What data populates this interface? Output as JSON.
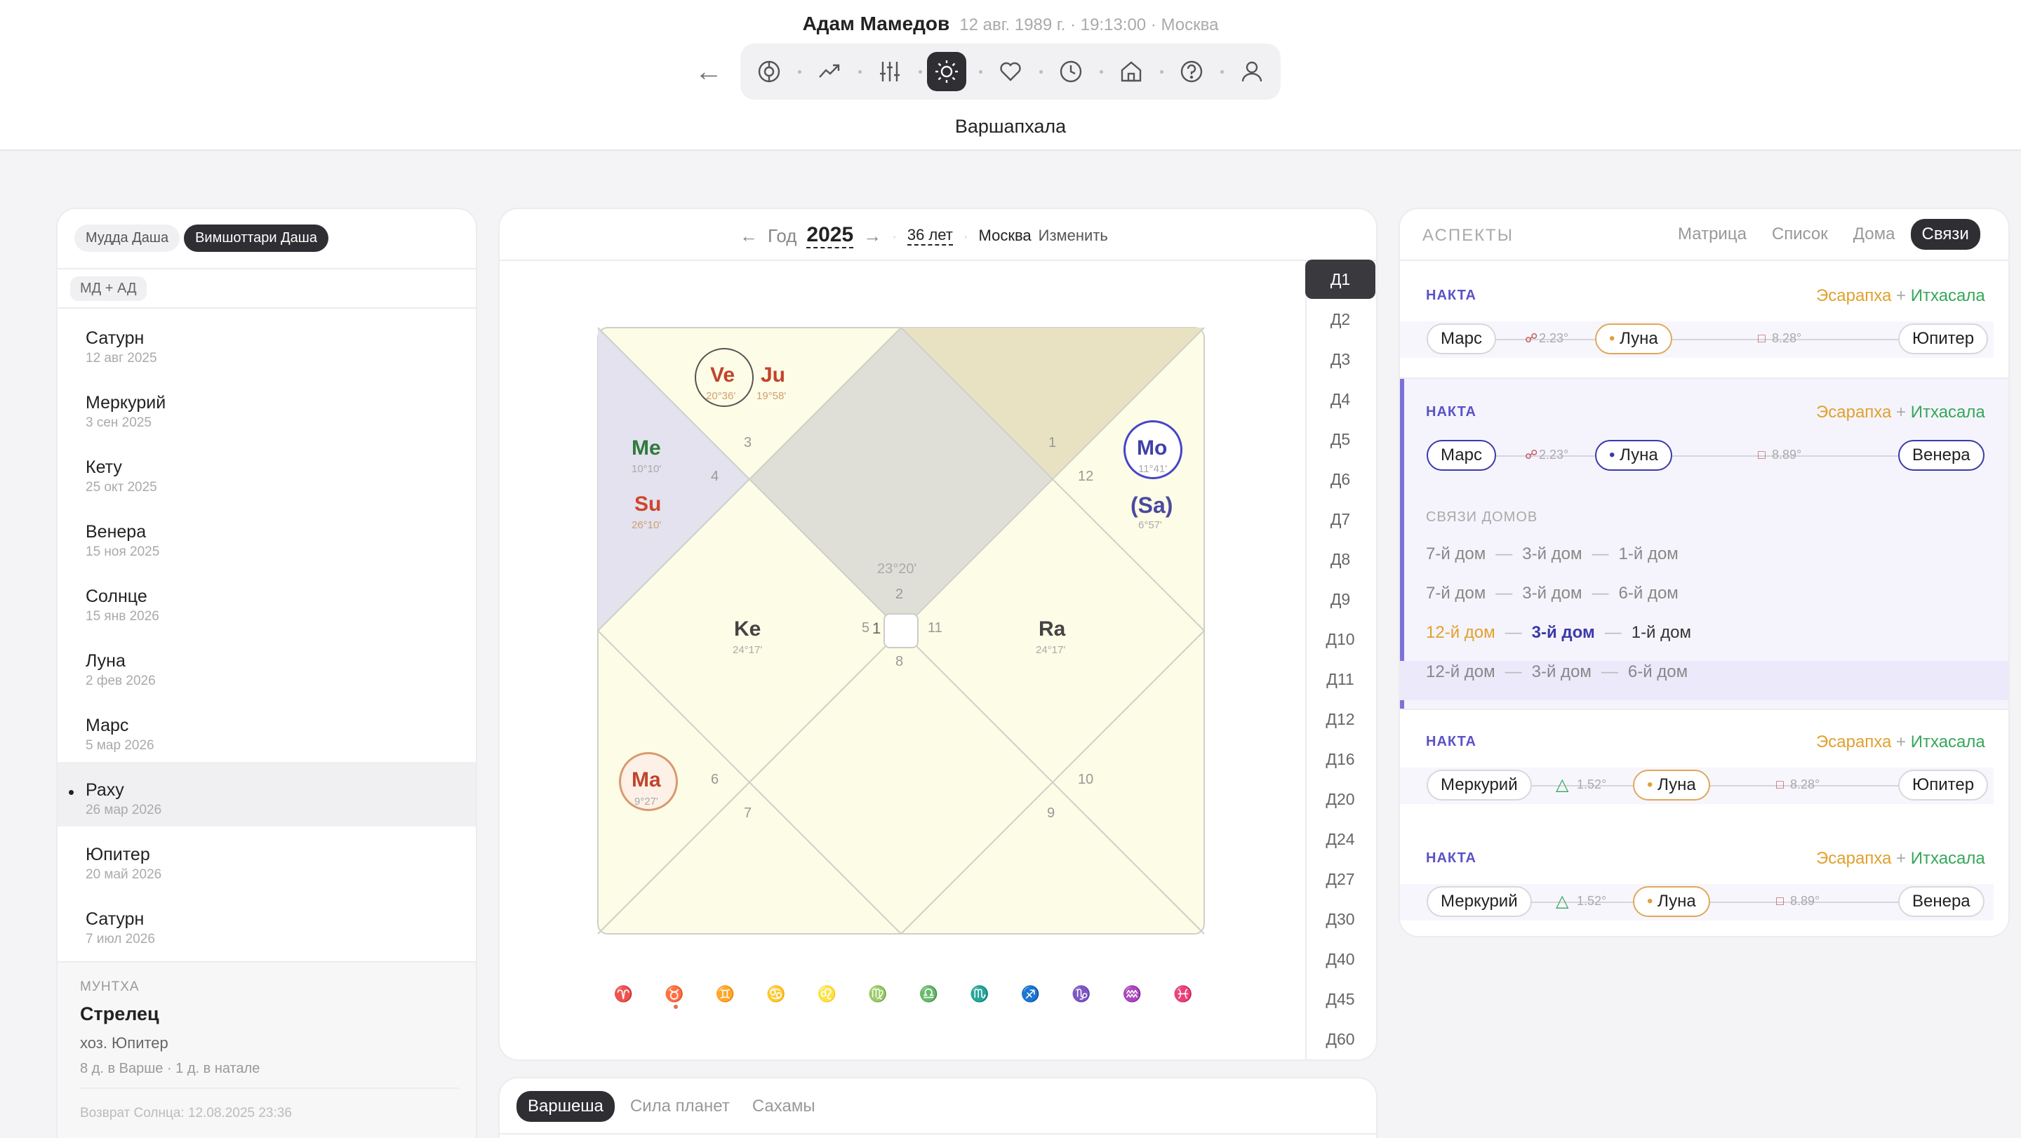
{
  "header": {
    "name": "Адам Мамедов",
    "subtitle": "12 авг. 1989 г. · 19:13:00 · Москва",
    "back": "←",
    "page_title": "Варшапхала"
  },
  "toolbar": {
    "icons": [
      "wheel-icon",
      "trend-icon",
      "sliders-icon",
      "sun-icon",
      "heart-icon",
      "clock-icon",
      "home-icon",
      "help-icon",
      "user-icon"
    ],
    "active": "sun-icon",
    "accent": "#2f2f33"
  },
  "left": {
    "tabs": [
      "Мудда Даша",
      "Вимшоттари Даша"
    ],
    "active_tab": "Вимшоттари Даша",
    "filter": "МД + АД",
    "items": [
      {
        "name": "Сатурн",
        "date": "12 авг 2025"
      },
      {
        "name": "Меркурий",
        "date": "3 сен 2025"
      },
      {
        "name": "Кету",
        "date": "25 окт 2025"
      },
      {
        "name": "Венера",
        "date": "15 ноя 2025"
      },
      {
        "name": "Солнце",
        "date": "15 янв 2026"
      },
      {
        "name": "Луна",
        "date": "2 фев 2026"
      },
      {
        "name": "Марс",
        "date": "5 мар 2026"
      },
      {
        "name": "Раху",
        "date": "26 мар 2026"
      },
      {
        "name": "Юпитер",
        "date": "20 май 2026"
      },
      {
        "name": "Сатурн",
        "date": "7 июл 2026"
      }
    ],
    "selected_index": 7,
    "muntha": {
      "label": "МУНТХА",
      "sign": "Стрелец",
      "lord": "хоз. Юпитер",
      "details": "8 д. в Варше · 1 д. в натале",
      "solar_return": "Возврат Солнца: 12.08.2025 23:36"
    }
  },
  "center": {
    "year_label": "Год",
    "year": "2025",
    "age": "36 лет",
    "city": "Москва",
    "change": "Изменить",
    "arrow_left": "←",
    "arrow_right": "→",
    "degree": "23°20'",
    "house_numbers": [
      "1",
      "2",
      "3",
      "4",
      "5",
      "6",
      "7",
      "8",
      "9",
      "10",
      "11",
      "12",
      "1"
    ],
    "planets": [
      {
        "abbr": "Ve",
        "deg": "20°36'",
        "color": "#c0442c"
      },
      {
        "abbr": "Ju",
        "deg": "19°58'",
        "color": "#c0442c"
      },
      {
        "abbr": "Me",
        "deg": "10°10'",
        "color": "#2f7a3a"
      },
      {
        "abbr": "Su",
        "deg": "26°10'",
        "color": "#d0442c"
      },
      {
        "abbr": "Mo",
        "deg": "11°41'",
        "color": "#4040a8"
      },
      {
        "abbr": "(Sa)",
        "deg": "6°57'",
        "color": "#4a4aa0"
      },
      {
        "abbr": "Ke",
        "deg": "24°17'",
        "color": "#444"
      },
      {
        "abbr": "Ra",
        "deg": "24°17'",
        "color": "#444"
      },
      {
        "abbr": "Ma",
        "deg": "9°27'",
        "color": "#c0442c"
      }
    ],
    "zodiac": [
      "♈",
      "♉",
      "♊",
      "♋",
      "♌",
      "♍",
      "♎",
      "♏",
      "♐",
      "♑",
      "♒",
      "♓"
    ],
    "div_tabs": [
      "Д1",
      "Д2",
      "Д3",
      "Д4",
      "Д5",
      "Д6",
      "Д7",
      "Д8",
      "Д9",
      "Д10",
      "Д11",
      "Д12",
      "Д16",
      "Д20",
      "Д24",
      "Д27",
      "Д30",
      "Д40",
      "Д45",
      "Д60"
    ],
    "active_div": "Д1",
    "bottom_tabs": [
      "Варшеша",
      "Сила планет",
      "Сахамы"
    ],
    "active_bottom": "Варшеша"
  },
  "aspects": {
    "title": "АСПЕКТЫ",
    "tabs": [
      "Матрица",
      "Список",
      "Дома",
      "Связи"
    ],
    "active_tab": "Связи",
    "cards": [
      {
        "label": "НАКТА",
        "yoga1": "Эсарапха",
        "plus": "+",
        "yoga2": "Итхасала",
        "a": "Марс",
        "ab": "2.23°",
        "b": "Луна",
        "bc": "8.28°",
        "c": "Юпитер"
      },
      {
        "label": "НАКТА",
        "yoga1": "Эсарапха",
        "plus": "+",
        "yoga2": "Итхасала",
        "a": "Марс",
        "ab": "2.23°",
        "b": "Луна",
        "bc": "8.89°",
        "c": "Венера"
      },
      {
        "label": "НАКТА",
        "yoga1": "Эсарапха",
        "plus": "+",
        "yoga2": "Итхасала",
        "a": "Меркурий",
        "ab": "1.52°",
        "b": "Луна",
        "bc": "8.28°",
        "c": "Юпитер"
      },
      {
        "label": "НАКТА",
        "yoga1": "Эсарапха",
        "plus": "+",
        "yoga2": "Итхасала",
        "a": "Меркурий",
        "ab": "1.52°",
        "b": "Луна",
        "bc": "8.89°",
        "c": "Венера"
      }
    ],
    "house_links": {
      "label": "СВЯЗИ ДОМОВ",
      "rows": [
        [
          "7-й дом",
          "3-й дом",
          "1-й дом"
        ],
        [
          "7-й дом",
          "3-й дом",
          "6-й дом"
        ],
        [
          "12-й дом",
          "3-й дом",
          "1-й дом"
        ],
        [
          "12-й дом",
          "3-й дом",
          "6-й дом"
        ]
      ],
      "dash": "—",
      "highlighted_row": 2
    }
  }
}
